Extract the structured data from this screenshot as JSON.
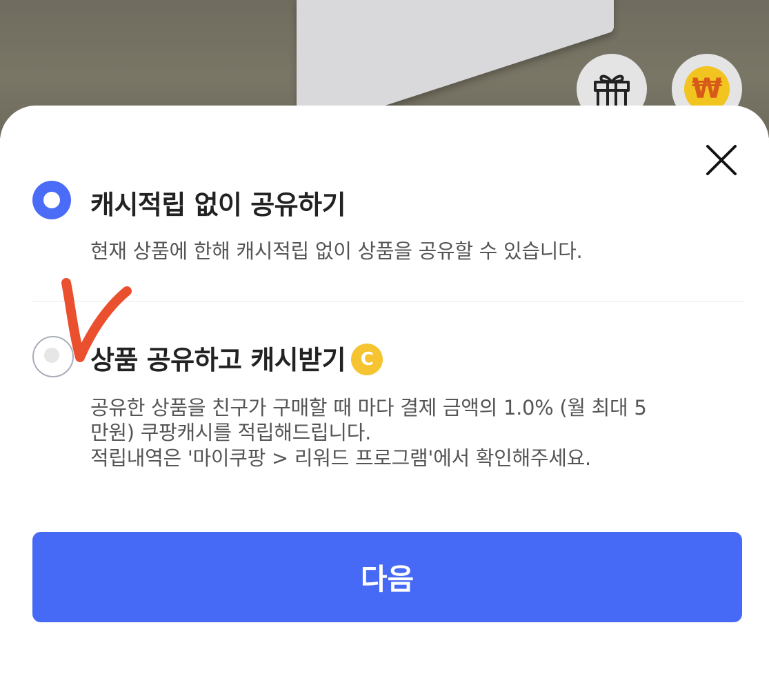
{
  "background": {
    "gift_icon": "gift-icon",
    "won_icon": "won-coin-icon",
    "won_symbol": "₩"
  },
  "sheet": {
    "close_icon": "close-icon",
    "options": [
      {
        "title": "캐시적립 없이 공유하기",
        "description_lines": [
          "현재 상품에 한해 캐시적립 없이 상품을 공유할 수 있습니다."
        ],
        "selected": true
      },
      {
        "title": "상품 공유하고 캐시받기",
        "badge": "C",
        "description_lines": [
          "공유한 상품을 친구가 구매할 때 마다 결제 금액의 1.0% (월 최대 5",
          "만원) 쿠팡캐시를 적립해드립니다.",
          "적립내역은 '마이쿠팡 > 리워드 프로그램'에서 확인해주세요."
        ],
        "selected": false
      }
    ],
    "next_button": "다음"
  },
  "colors": {
    "accent": "#466af5",
    "badge": "#f5c430",
    "annotation": "#e8401c"
  }
}
